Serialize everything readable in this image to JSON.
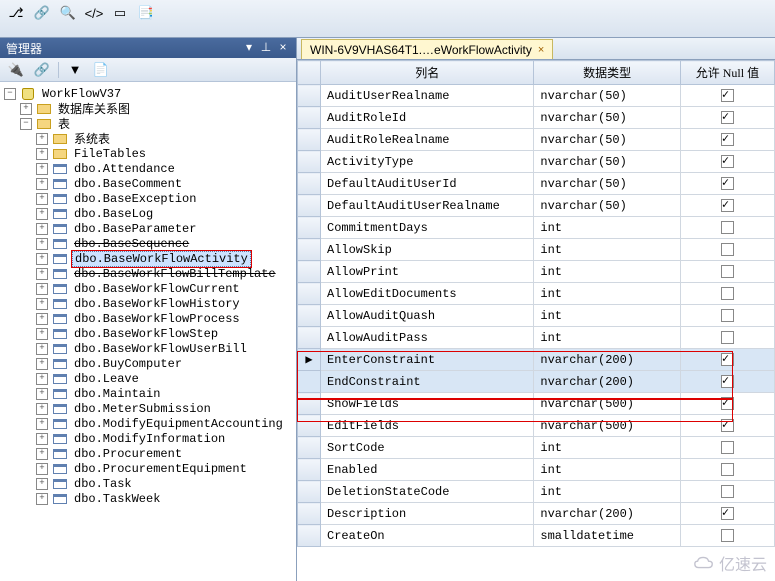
{
  "toolbar_icons": [
    "branch-icon",
    "link-icon",
    "find-replace-icon",
    "xml-icon",
    "window-icon",
    "bookmark-icon"
  ],
  "panel": {
    "title": "管理器",
    "toolbar_icons": [
      "connect-icon",
      "link-icon",
      "separator",
      "filter-icon",
      "script-icon"
    ]
  },
  "tree": {
    "root_label": "WorkFlowV37",
    "nodes": [
      {
        "depth": 1,
        "exp": "+",
        "icon": "folder",
        "label": "数据库关系图"
      },
      {
        "depth": 1,
        "exp": "-",
        "icon": "folder",
        "label": "表"
      },
      {
        "depth": 2,
        "exp": "+",
        "icon": "folder",
        "label": "系统表"
      },
      {
        "depth": 2,
        "exp": "+",
        "icon": "folder",
        "label": "FileTables"
      },
      {
        "depth": 2,
        "exp": "+",
        "icon": "table",
        "label": "dbo.Attendance"
      },
      {
        "depth": 2,
        "exp": "+",
        "icon": "table",
        "label": "dbo.BaseComment"
      },
      {
        "depth": 2,
        "exp": "+",
        "icon": "table",
        "label": "dbo.BaseException"
      },
      {
        "depth": 2,
        "exp": "+",
        "icon": "table",
        "label": "dbo.BaseLog"
      },
      {
        "depth": 2,
        "exp": "+",
        "icon": "table",
        "label": "dbo.BaseParameter"
      },
      {
        "depth": 2,
        "exp": "+",
        "icon": "table",
        "label": "dbo.BaseSequence",
        "strike": true
      },
      {
        "depth": 2,
        "exp": "+",
        "icon": "table",
        "label": "dbo.BaseWorkFlowActivity",
        "selected": true,
        "redbox": true
      },
      {
        "depth": 2,
        "exp": "+",
        "icon": "table",
        "label": "dbo.BaseWorkFlowBillTemplate",
        "strike": true
      },
      {
        "depth": 2,
        "exp": "+",
        "icon": "table",
        "label": "dbo.BaseWorkFlowCurrent"
      },
      {
        "depth": 2,
        "exp": "+",
        "icon": "table",
        "label": "dbo.BaseWorkFlowHistory"
      },
      {
        "depth": 2,
        "exp": "+",
        "icon": "table",
        "label": "dbo.BaseWorkFlowProcess"
      },
      {
        "depth": 2,
        "exp": "+",
        "icon": "table",
        "label": "dbo.BaseWorkFlowStep"
      },
      {
        "depth": 2,
        "exp": "+",
        "icon": "table",
        "label": "dbo.BaseWorkFlowUserBill"
      },
      {
        "depth": 2,
        "exp": "+",
        "icon": "table",
        "label": "dbo.BuyComputer"
      },
      {
        "depth": 2,
        "exp": "+",
        "icon": "table",
        "label": "dbo.Leave"
      },
      {
        "depth": 2,
        "exp": "+",
        "icon": "table",
        "label": "dbo.Maintain"
      },
      {
        "depth": 2,
        "exp": "+",
        "icon": "table",
        "label": "dbo.MeterSubmission"
      },
      {
        "depth": 2,
        "exp": "+",
        "icon": "table",
        "label": "dbo.ModifyEquipmentAccounting"
      },
      {
        "depth": 2,
        "exp": "+",
        "icon": "table",
        "label": "dbo.ModifyInformation"
      },
      {
        "depth": 2,
        "exp": "+",
        "icon": "table",
        "label": "dbo.Procurement"
      },
      {
        "depth": 2,
        "exp": "+",
        "icon": "table",
        "label": "dbo.ProcurementEquipment"
      },
      {
        "depth": 2,
        "exp": "+",
        "icon": "table",
        "label": "dbo.Task"
      },
      {
        "depth": 2,
        "exp": "+",
        "icon": "table",
        "label": "dbo.TaskWeek"
      }
    ]
  },
  "tab": {
    "label": "WIN-6V9VHAS64T1.…eWorkFlowActivity",
    "close": "×"
  },
  "grid": {
    "headers": {
      "col_name": "列名",
      "col_type": "数据类型",
      "col_null": "允许 Null 值"
    },
    "rows": [
      {
        "name": "AuditUserRealname",
        "type": "nvarchar(50)",
        "nullable": true
      },
      {
        "name": "AuditRoleId",
        "type": "nvarchar(50)",
        "nullable": true
      },
      {
        "name": "AuditRoleRealname",
        "type": "nvarchar(50)",
        "nullable": true
      },
      {
        "name": "ActivityType",
        "type": "nvarchar(50)",
        "nullable": true
      },
      {
        "name": "DefaultAuditUserId",
        "type": "nvarchar(50)",
        "nullable": true
      },
      {
        "name": "DefaultAuditUserRealname",
        "type": "nvarchar(50)",
        "nullable": true
      },
      {
        "name": "CommitmentDays",
        "type": "int",
        "nullable": false
      },
      {
        "name": "AllowSkip",
        "type": "int",
        "nullable": false
      },
      {
        "name": "AllowPrint",
        "type": "int",
        "nullable": false
      },
      {
        "name": "AllowEditDocuments",
        "type": "int",
        "nullable": false
      },
      {
        "name": "AllowAuditQuash",
        "type": "int",
        "nullable": false
      },
      {
        "name": "AllowAuditPass",
        "type": "int",
        "nullable": false
      },
      {
        "name": "EnterConstraint",
        "type": "nvarchar(200)",
        "nullable": true,
        "selected": true,
        "indicator": "▶"
      },
      {
        "name": "EndConstraint",
        "type": "nvarchar(200)",
        "nullable": true,
        "selected": true
      },
      {
        "name": "ShowFields",
        "type": "nvarchar(500)",
        "nullable": true
      },
      {
        "name": "EditFields",
        "type": "nvarchar(500)",
        "nullable": true
      },
      {
        "name": "SortCode",
        "type": "int",
        "nullable": false
      },
      {
        "name": "Enabled",
        "type": "int",
        "nullable": false
      },
      {
        "name": "DeletionStateCode",
        "type": "int",
        "nullable": false
      },
      {
        "name": "Description",
        "type": "nvarchar(200)",
        "nullable": true
      },
      {
        "name": "CreateOn",
        "type": "smalldatetime",
        "nullable": false
      }
    ]
  },
  "watermark": "亿速云"
}
